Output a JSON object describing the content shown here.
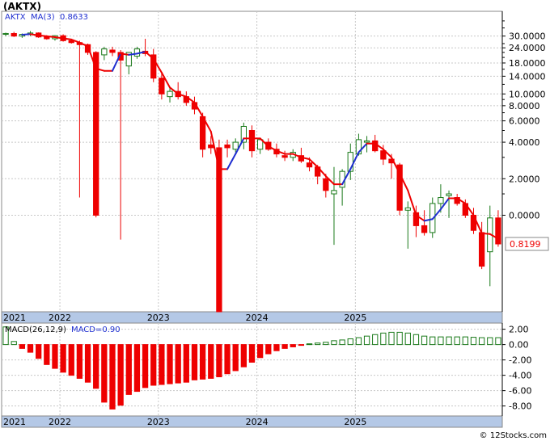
{
  "title": "(AKTX)",
  "credit": "© 12Stocks.com",
  "price_legend": {
    "ticker": "AKTX",
    "ma_label": "MA(3)",
    "ma_value": "0.8633"
  },
  "macd_legend": {
    "label": "MACD(26,12,9)",
    "value_label": "MACD=0.90"
  },
  "last_price_label": "0.8199",
  "colors": {
    "up": "#1a7a1a",
    "down": "#ee0000",
    "ma_down": "#ee0000",
    "ma_up": "#1f2fd0",
    "grid": "#c8c8c8",
    "axis_band": "#b4c8e6",
    "tag_text": "#ee0000"
  },
  "chart_data": [
    {
      "type": "candlestick",
      "scale": "log",
      "y_tick_labels": [
        "30.0000",
        "24.0000",
        "18.0000",
        "14.0000",
        "10.0000",
        "8.0000",
        "6.0000",
        "4.0000",
        "2.0000",
        "0.0000"
      ],
      "y_tick_values": [
        30,
        24,
        18,
        14,
        10,
        8,
        6,
        4,
        2,
        0
      ],
      "x_tick_labels": [
        "2021",
        "2022",
        "2023",
        "2024",
        "2025"
      ],
      "ylim": [
        0.16,
        48
      ],
      "ma_label": "MA(3)",
      "candles": [
        [
          31.0,
          32.0,
          30.0,
          31.5
        ],
        [
          31.5,
          32.5,
          29.5,
          30.0
        ],
        [
          30.0,
          31.5,
          29.0,
          31.0
        ],
        [
          31.0,
          33.0,
          30.0,
          31.8
        ],
        [
          31.8,
          32.2,
          29.0,
          29.5
        ],
        [
          29.5,
          30.5,
          28.0,
          28.5
        ],
        [
          28.5,
          30.5,
          27.5,
          30.2
        ],
        [
          30.2,
          31.0,
          27.0,
          27.5
        ],
        [
          27.5,
          28.2,
          26.0,
          26.5
        ],
        [
          26.5,
          27.5,
          1.4,
          25.5
        ],
        [
          25.5,
          26.0,
          21.0,
          22.0
        ],
        [
          22.0,
          22.5,
          0.96,
          1.0
        ],
        [
          21.0,
          24.5,
          19.0,
          23.5
        ],
        [
          23.0,
          24.5,
          20.5,
          22.0
        ],
        [
          22.0,
          23.0,
          0.63,
          19.0
        ],
        [
          17.0,
          22.0,
          14.5,
          22.0
        ],
        [
          20.5,
          24.5,
          19.5,
          23.5
        ],
        [
          22.5,
          28.5,
          20.5,
          21.5
        ],
        [
          21.0,
          23.5,
          12.5,
          13.5
        ],
        [
          13.5,
          15.0,
          9.0,
          10.0
        ],
        [
          9.5,
          11.5,
          8.5,
          10.5
        ],
        [
          10.5,
          12.5,
          9.0,
          9.5
        ],
        [
          9.5,
          10.5,
          8.0,
          8.5
        ],
        [
          8.5,
          9.5,
          6.8,
          7.5
        ],
        [
          6.5,
          7.0,
          3.0,
          3.5
        ],
        [
          3.8,
          4.5,
          3.2,
          3.6
        ],
        [
          3.6,
          4.2,
          0.1,
          0.12
        ],
        [
          3.8,
          4.2,
          3.0,
          3.6
        ],
        [
          3.5,
          4.3,
          3.3,
          4.0
        ],
        [
          4.0,
          5.8,
          3.5,
          5.4
        ],
        [
          5.0,
          5.5,
          3.0,
          3.4
        ],
        [
          3.5,
          4.3,
          3.2,
          4.2
        ],
        [
          4.0,
          4.3,
          3.4,
          3.5
        ],
        [
          3.5,
          3.9,
          3.0,
          3.2
        ],
        [
          3.1,
          3.4,
          2.8,
          3.0
        ],
        [
          3.0,
          3.5,
          2.8,
          3.3
        ],
        [
          3.1,
          3.6,
          2.7,
          2.8
        ],
        [
          2.7,
          3.0,
          2.3,
          2.5
        ],
        [
          2.5,
          2.6,
          1.8,
          2.1
        ],
        [
          2.0,
          2.2,
          1.4,
          1.6
        ],
        [
          1.5,
          2.5,
          0.57,
          1.6
        ],
        [
          1.7,
          2.4,
          1.2,
          2.3
        ],
        [
          2.3,
          3.9,
          1.95,
          3.3
        ],
        [
          3.2,
          4.7,
          3.1,
          4.2
        ],
        [
          4.0,
          4.5,
          3.3,
          4.1
        ],
        [
          4.1,
          4.6,
          3.3,
          3.4
        ],
        [
          3.4,
          3.8,
          2.6,
          2.9
        ],
        [
          2.9,
          3.2,
          2.0,
          2.7
        ],
        [
          2.6,
          2.7,
          1.0,
          1.1
        ],
        [
          1.1,
          1.3,
          0.53,
          1.15
        ],
        [
          1.05,
          1.2,
          0.66,
          0.82
        ],
        [
          0.82,
          1.1,
          0.68,
          0.72
        ],
        [
          0.72,
          1.4,
          0.65,
          1.25
        ],
        [
          1.25,
          1.8,
          1.05,
          1.4
        ],
        [
          1.45,
          1.6,
          0.95,
          1.5
        ],
        [
          1.4,
          1.5,
          1.2,
          1.25
        ],
        [
          1.25,
          1.35,
          0.95,
          1.0
        ],
        [
          1.0,
          1.15,
          0.7,
          0.75
        ],
        [
          0.72,
          0.88,
          0.36,
          0.38
        ],
        [
          0.5,
          1.2,
          0.26,
          0.95
        ],
        [
          0.95,
          1.1,
          0.55,
          0.58
        ]
      ],
      "ma3": [
        null,
        null,
        30.8,
        31.1,
        30.4,
        29.9,
        29.4,
        28.7,
        28.1,
        26.5,
        24.7,
        16.2,
        15.5,
        15.5,
        21.5,
        21.0,
        21.5,
        22.3,
        19.5,
        15.0,
        11.3,
        10.0,
        9.5,
        8.5,
        6.5,
        4.9,
        2.4,
        2.4,
        3.2,
        4.3,
        4.3,
        4.3,
        3.7,
        3.4,
        3.2,
        3.2,
        3.0,
        2.9,
        2.5,
        2.1,
        1.8,
        1.8,
        2.4,
        3.3,
        3.9,
        3.9,
        3.5,
        3.0,
        2.2,
        1.6,
        1.0,
        0.9,
        0.93,
        1.12,
        1.38,
        1.38,
        1.25,
        1.0,
        0.71,
        0.7,
        0.64
      ]
    },
    {
      "type": "bar",
      "ylim": [
        -9.3,
        2.8
      ],
      "y_tick_labels": [
        "2.00",
        "0.00",
        "-2.00",
        "-4.00",
        "-6.00",
        "-8.00"
      ],
      "y_tick_values": [
        2,
        0,
        -2,
        -4,
        -6,
        -8
      ],
      "x_tick_labels": [
        "2021",
        "2022",
        "2023",
        "2024",
        "2025"
      ],
      "values": [
        2.3,
        0.4,
        -0.5,
        -1.0,
        -1.8,
        -2.6,
        -3.1,
        -3.6,
        -4.0,
        -4.4,
        -4.9,
        -5.7,
        -7.5,
        -8.4,
        -7.9,
        -6.5,
        -6.1,
        -5.6,
        -5.3,
        -5.2,
        -5.1,
        -5.0,
        -4.9,
        -4.6,
        -4.5,
        -4.4,
        -4.2,
        -3.8,
        -3.4,
        -2.9,
        -2.3,
        -1.7,
        -1.2,
        -0.8,
        -0.5,
        -0.3,
        -0.1,
        0.1,
        0.2,
        0.3,
        0.5,
        0.6,
        0.75,
        0.9,
        1.1,
        1.3,
        1.5,
        1.6,
        1.6,
        1.5,
        1.3,
        1.1,
        1.0,
        1.0,
        1.0,
        1.0,
        1.0,
        0.95,
        0.9,
        0.9,
        0.9
      ]
    }
  ]
}
